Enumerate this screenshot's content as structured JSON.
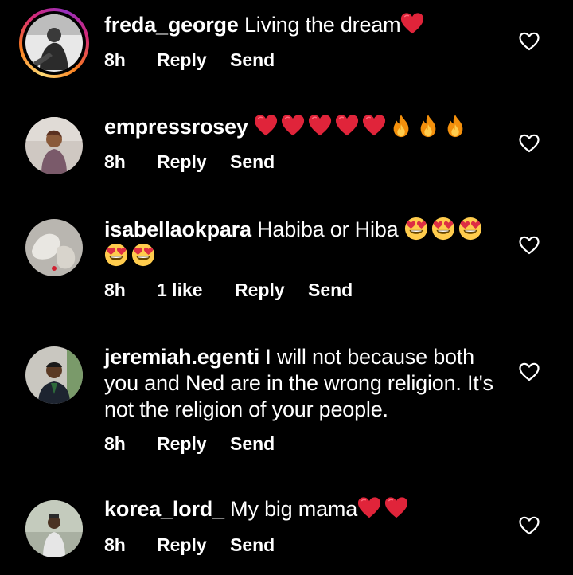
{
  "comments": [
    {
      "username": "freda_george",
      "text": " Living the dream",
      "emojis": [
        "red-heart"
      ],
      "time": "8h",
      "likes": "",
      "reply_label": "Reply",
      "send_label": "Send",
      "has_story_ring": true
    },
    {
      "username": "empressrosey",
      "text": " ",
      "emojis": [
        "red-heart",
        "red-heart",
        "red-heart",
        "red-heart",
        "red-heart",
        "fire",
        "fire",
        "fire"
      ],
      "time": "8h",
      "likes": "",
      "reply_label": "Reply",
      "send_label": "Send",
      "has_story_ring": false
    },
    {
      "username": "isabellaokpara",
      "text": " Habiba or Hiba ",
      "emojis": [
        "heart-eyes",
        "heart-eyes",
        "heart-eyes",
        "heart-eyes",
        "heart-eyes"
      ],
      "time": "8h",
      "likes": "1 like",
      "reply_label": "Reply",
      "send_label": "Send",
      "has_story_ring": false
    },
    {
      "username": "jeremiah.egenti",
      "text": " I will not because both you and Ned are in the wrong religion. It's not the religion of your people.",
      "emojis": [],
      "time": "8h",
      "likes": "",
      "reply_label": "Reply",
      "send_label": "Send",
      "has_story_ring": false
    },
    {
      "username": "korea_lord_",
      "text": " My big mama",
      "emojis": [
        "red-heart",
        "red-heart"
      ],
      "time": "8h",
      "likes": "",
      "reply_label": "Reply",
      "send_label": "Send",
      "has_story_ring": false
    }
  ],
  "colors": {
    "background": "#000000",
    "text": "#ffffff",
    "heart_emoji": "#e0243a",
    "story_ring": [
      "#feda75",
      "#fa7e1e",
      "#d62976",
      "#962fbf"
    ]
  },
  "icons": {
    "like": "heart-outline-icon"
  }
}
